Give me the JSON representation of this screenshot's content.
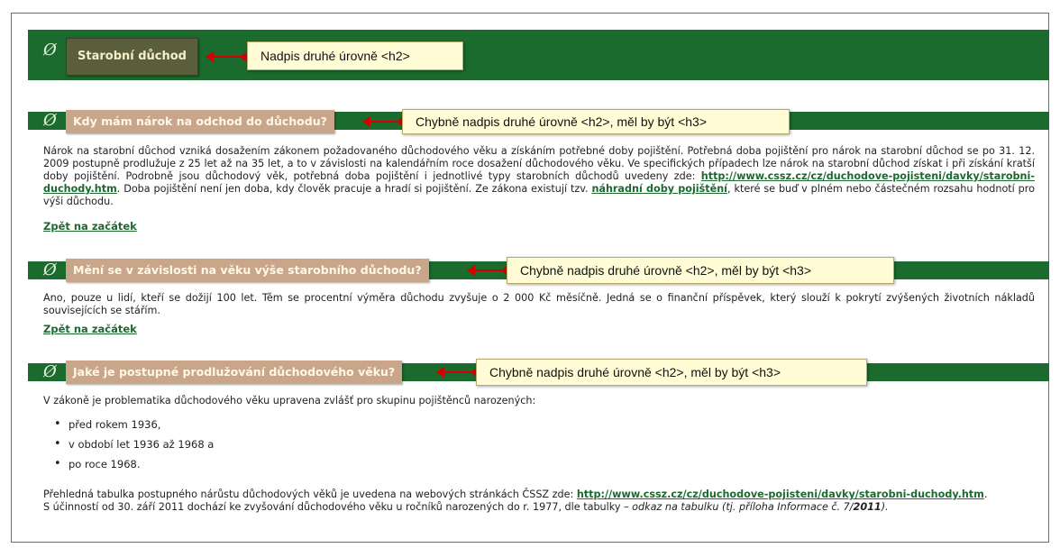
{
  "sections": [
    {
      "heading": "Starobní důchod",
      "callout": "Nadpis druhé úrovně <h2>"
    },
    {
      "heading": "Kdy mám nárok na odchod do důchodu?",
      "callout": "Chybně nadpis druhé úrovně <h2>, měl by být <h3>",
      "text_1": "Nárok na starobní důchod vzniká dosažením zákonem požadovaného důchodového věku a získáním potřebné doby pojištění. Potřebná doba pojištění pro nárok na starobní důchod se po 31. 12. 2009 postupně prodlužuje z 25 let až na 35 let, a to v závislosti na kalendářním roce dosažení důchodového věku. Ve specifických případech lze nárok na starobní důchod získat i při získání kratší doby pojištění. Podrobně jsou důchodový věk, potřebná doba pojištění i jednotlivé typy starobních důchodů uvedeny zde: ",
      "link_1": "http://www.cssz.cz/cz/duchodove-pojisteni/davky/starobni-duchody.htm",
      "text_2": ". Doba pojištění není jen doba, kdy člověk pracuje a hradí si pojištění. Ze zákona existují tzv. ",
      "link_2": "náhradní doby pojištění",
      "text_3": ", které se buď v plném nebo částečném rozsahu hodnotí pro výši důchodu.",
      "back": "Zpět na začátek"
    },
    {
      "heading": "Mění se v závislosti na věku výše starobního důchodu?",
      "callout": "Chybně nadpis druhé úrovně <h2>, měl by být <h3>",
      "text": "Ano, pouze u lidí, kteří se dožijí 100 let. Těm se procentní výměra důchodu zvyšuje o 2 000 Kč měsíčně. Jedná se o finanční příspěvek, který slouží k pokrytí zvýšených životních nákladů souvisejících se stářím.",
      "back": "Zpět na začátek"
    },
    {
      "heading": "Jaké je postupné prodlužování důchodového věku?",
      "callout": "Chybně nadpis druhé úrovně <h2>, měl by být <h3>",
      "intro": "V zákoně je problematika důchodového věku upravena zvlášť pro skupinu pojištěnců narozených:",
      "items": [
        "před rokem 1936,",
        "v období let 1936 až 1968 a",
        "po roce 1968."
      ],
      "text_1": "Přehledná tabulka postupného nárůstu důchodových věků je uvedena na webových stránkách ČSSZ zde: ",
      "link_1": "http://www.cssz.cz/cz/duchodove-pojisteni/davky/starobni-duchody.htm",
      "text_2": ".",
      "text_3": "S účinností od 30. září 2011 dochází ke zvyšování důchodového věku u ročníků narozených do r. 1977, dle tabulky – ",
      "italic_1": "odkaz na tabulku (tj. příloha Informace č. 7/",
      "italic_bold": "2011",
      "italic_2": ")."
    }
  ],
  "leaf_glyph": "Ø",
  "colors": {
    "bar": "#1b6a2e",
    "callout_bg": "#fffcd6",
    "arrow": "#d50000",
    "link": "#1b6a2e"
  }
}
